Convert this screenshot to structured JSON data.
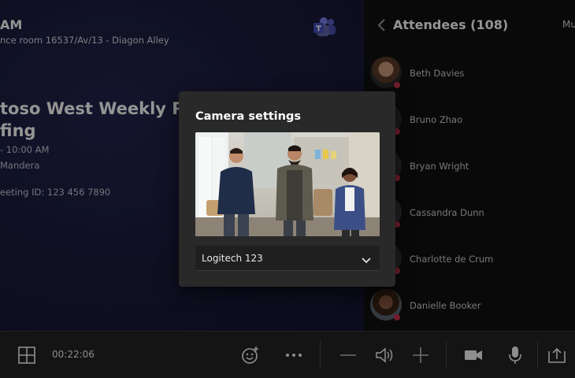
{
  "meeting": {
    "time_title": "AM",
    "room": "nce room 16537/Av/13 - Diagon Alley",
    "title_line1": "toso West Weekly Proje",
    "title_line2": "fing",
    "time_range": "- 10:00 AM",
    "organizer": "Mandera",
    "meeting_id": "eeting ID: 123 456 7890"
  },
  "attendees_panel": {
    "title": "Attendees (108)",
    "mute_label": "Mu",
    "items": [
      {
        "name": "Beth Davies",
        "avatar": "photo"
      },
      {
        "name": "Bruno Zhao",
        "avatar": "photo"
      },
      {
        "name": "Bryan Wright",
        "avatar": "photo"
      },
      {
        "name": "Cassandra Dunn",
        "avatar": "photo"
      },
      {
        "name": "Charlotte de Crum",
        "avatar": "photo"
      },
      {
        "name": "Danielle Booker",
        "avatar": "photo"
      }
    ]
  },
  "camera_modal": {
    "title": "Camera settings",
    "selected_camera": "Logitech 123"
  },
  "toolbar": {
    "timer": "00:22:06",
    "icons": [
      "grid-icon",
      "reaction-icon",
      "more-icon",
      "volume-down-icon",
      "speaker-icon",
      "volume-up-icon",
      "camera-icon",
      "microphone-icon",
      "share-tray-icon"
    ]
  },
  "colors": {
    "meeting_bg": "#1b1c3d",
    "panel_bg": "#101010",
    "modal_bg": "#292929",
    "presence_busy": "#c4314b"
  }
}
